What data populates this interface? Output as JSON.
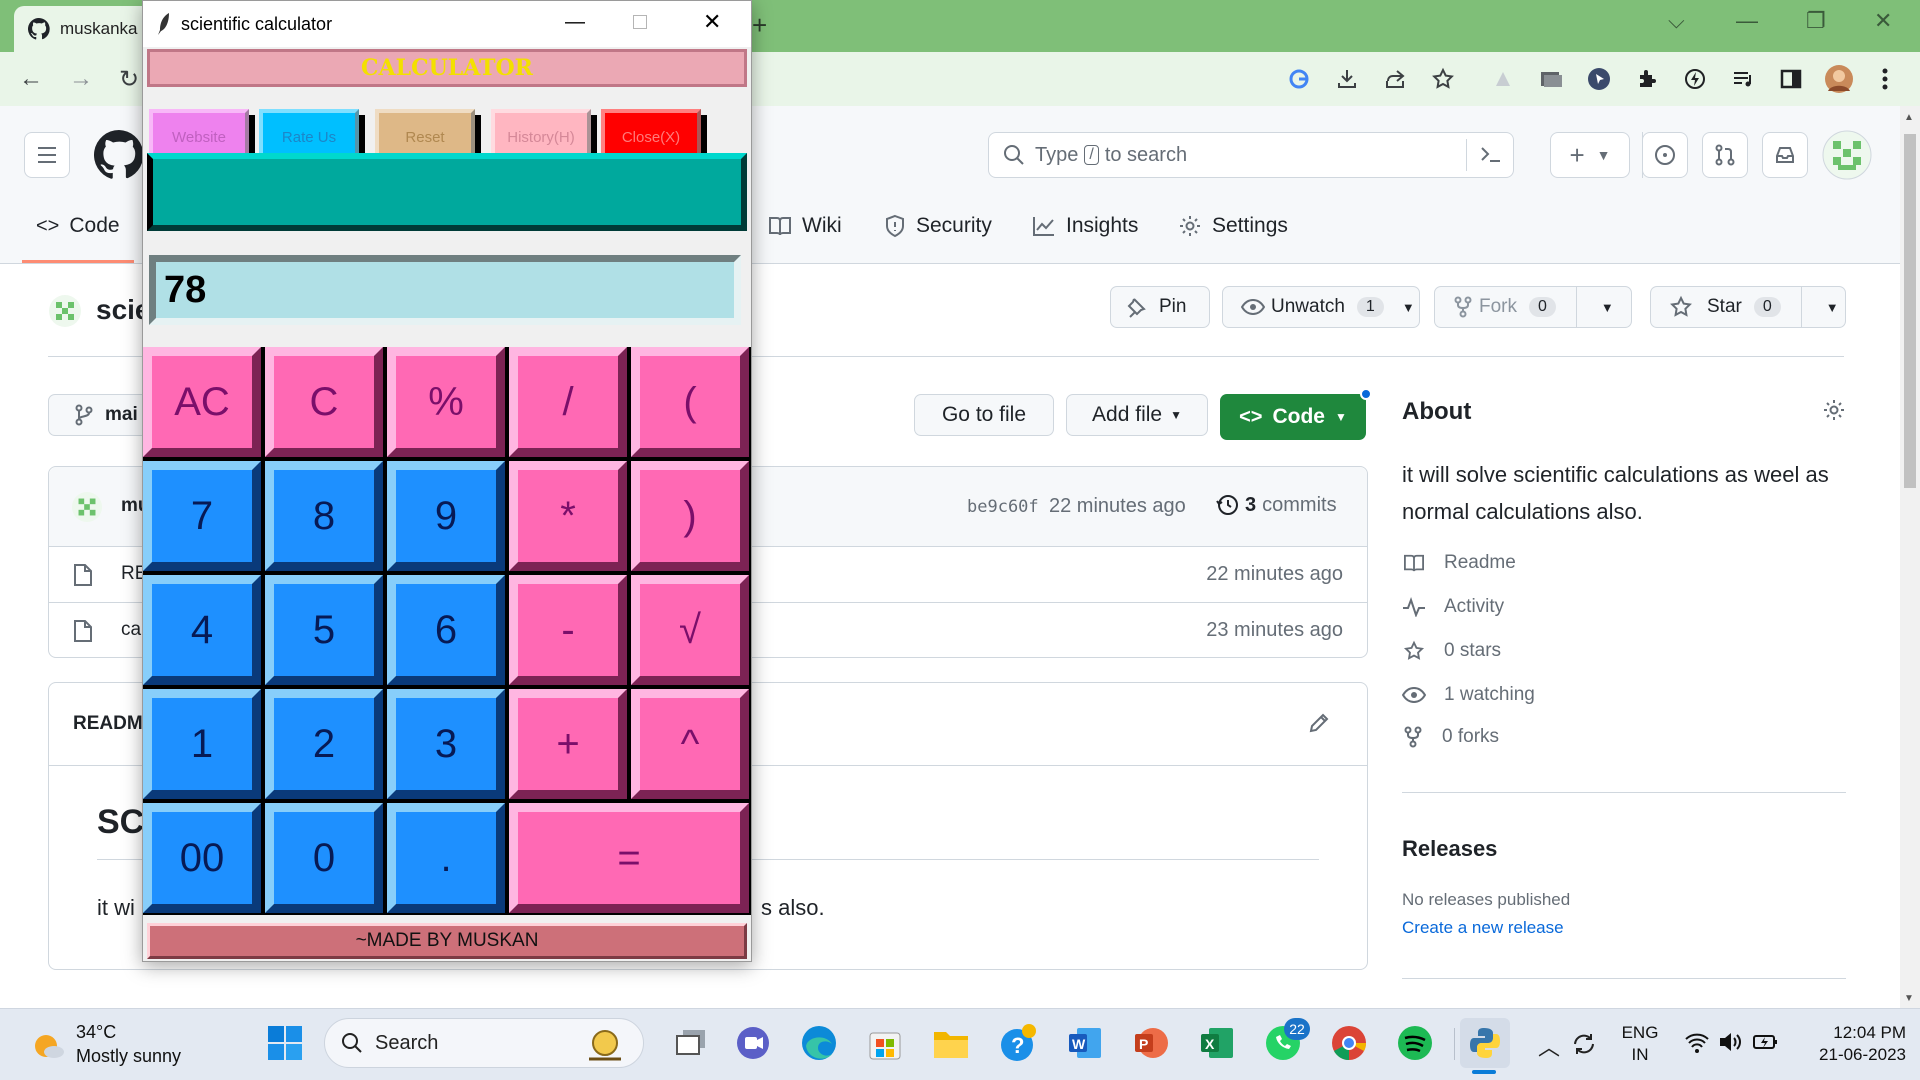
{
  "browser": {
    "tab_title": "muskanka",
    "tab_new": "+"
  },
  "github": {
    "search_placeholder_a": "Type",
    "search_placeholder_key": "/",
    "search_placeholder_b": "to search",
    "nav": {
      "code": "Code",
      "wiki": "Wiki",
      "security": "Security",
      "insights": "Insights",
      "settings": "Settings"
    },
    "repo_name_partial": "scie",
    "actions": {
      "pin": "Pin",
      "unwatch": "Unwatch",
      "unwatch_count": "1",
      "fork": "Fork",
      "fork_count": "0",
      "star": "Star",
      "star_count": "0"
    },
    "branch_partial": "mai",
    "go_to_file": "Go to file",
    "add_file": "Add file",
    "code_button": "Code",
    "commit": {
      "author_partial": "mu",
      "hash": "be9c60f",
      "time": "22 minutes ago",
      "count": "3",
      "count_label": "commits"
    },
    "files": [
      {
        "name_partial": "RE",
        "time": "22 minutes ago"
      },
      {
        "name_partial": "ca",
        "time": "23 minutes ago"
      }
    ],
    "readme": {
      "label_partial": "READM",
      "heading_partial": "SC",
      "text_start": "it wi",
      "text_end": "s also."
    },
    "about": {
      "title": "About",
      "description": "it will solve scientific calculations as weel as normal calculations also.",
      "readme": "Readme",
      "activity": "Activity",
      "stars": "0 stars",
      "watching": "1 watching",
      "forks": "0 forks"
    },
    "releases": {
      "title": "Releases",
      "none": "No releases published",
      "create": "Create a new release"
    }
  },
  "calculator": {
    "window_title": "scientific calculator",
    "banner": "CALCULATOR",
    "top_buttons": [
      {
        "label": "Website",
        "bg": "#ee82ee",
        "fg": "#c060c0"
      },
      {
        "label": "Rate Us",
        "bg": "#00bfff",
        "fg": "#1c86c8"
      },
      {
        "label": "Reset",
        "bg": "#deb887",
        "fg": "#b08850"
      },
      {
        "label": "History(H)",
        "bg": "#ffb6c1",
        "fg": "#d58898"
      },
      {
        "label": "Close(X)",
        "bg": "#ff0000",
        "fg": "#ff7a7a"
      }
    ],
    "display_value": "78",
    "keys": {
      "ac": "AC",
      "c": "C",
      "percent": "%",
      "divide": "/",
      "lparen": "(",
      "k7": "7",
      "k8": "8",
      "k9": "9",
      "multiply": "*",
      "rparen": ")",
      "k4": "4",
      "k5": "5",
      "k6": "6",
      "minus": "-",
      "sqrt": "√",
      "k1": "1",
      "k2": "2",
      "k3": "3",
      "plus": "+",
      "power": "^",
      "k00": "00",
      "k0": "0",
      "dot": ".",
      "equals": "="
    },
    "footer": "~MADE BY MUSKAN"
  },
  "taskbar": {
    "weather_temp": "34°C",
    "weather_desc": "Mostly sunny",
    "search": "Search",
    "whatsapp_badge": "22",
    "lang": "ENG",
    "region": "IN",
    "time": "12:04 PM",
    "date": "21-06-2023"
  },
  "colors": {
    "github_green": "#1f883d",
    "calc_pink": "#ff69b4",
    "calc_blue": "#1e90ff",
    "calc_teal": "#00a99d",
    "display_bg": "#b0e0e6",
    "link_blue": "#0969da"
  }
}
